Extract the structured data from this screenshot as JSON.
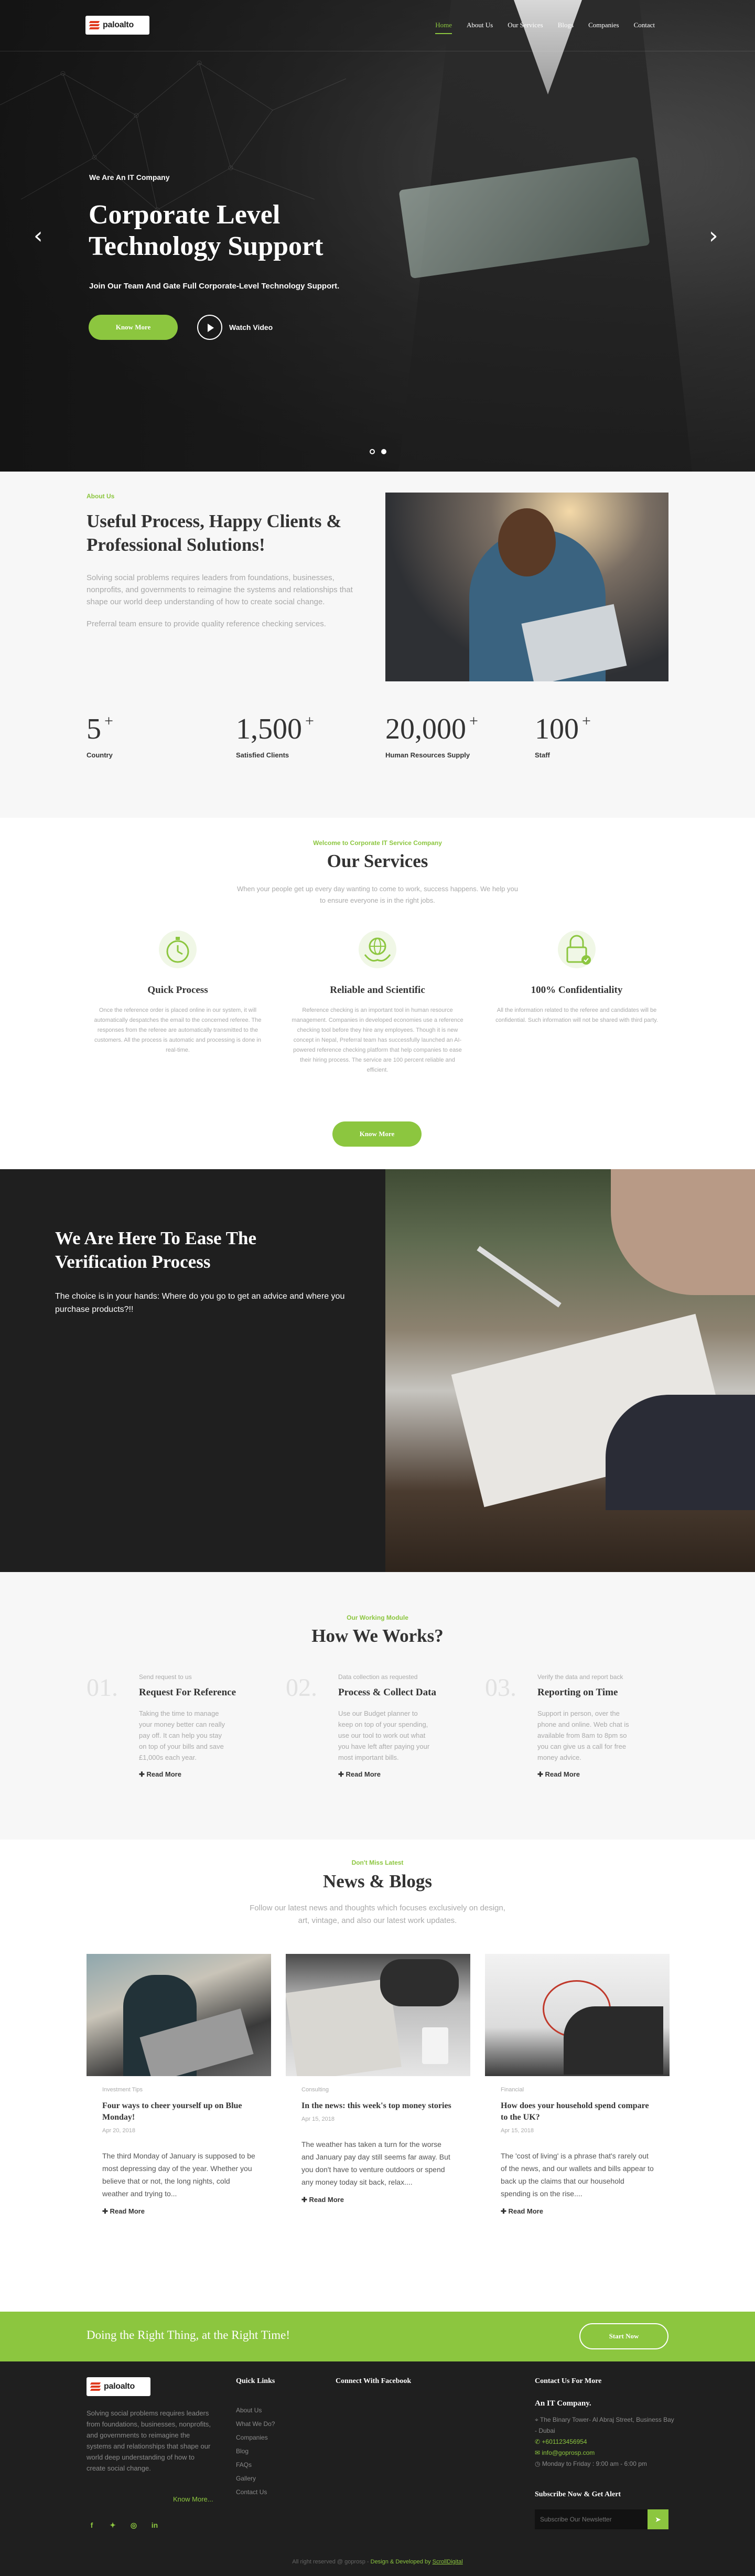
{
  "brand": {
    "name": "paloalto",
    "accent": "#8cc63f",
    "dark": "#1f1f1f"
  },
  "nav": [
    {
      "label": "Home",
      "active": true
    },
    {
      "label": "About Us"
    },
    {
      "label": "Our Services"
    },
    {
      "label": "Blogs"
    },
    {
      "label": "Companies"
    },
    {
      "label": "Contact"
    }
  ],
  "hero": {
    "eyebrow": "We Are An IT Company",
    "title_line1": "Corporate Level",
    "title_line2": "Technology Support",
    "subtitle": "Join Our Team And Gate Full Corporate-Level Technology Support.",
    "button": "Know More",
    "video_label": "Watch Video",
    "prev_icon": "chevron-left-icon",
    "next_icon": "chevron-right-icon"
  },
  "about": {
    "eyebrow": "About Us",
    "title": "Useful Process, Happy Clients & Professional Solutions!",
    "para1": "Solving social problems requires leaders from foundations, businesses, nonprofits, and governments to reimagine the systems and relationships that shape our world deep understanding of how to create social change.",
    "para2": "Preferral team ensure to provide quality reference checking services."
  },
  "stats": [
    {
      "value": "5",
      "label": "Country"
    },
    {
      "value": "1,500",
      "label": "Satisfied Clients"
    },
    {
      "value": "20,000",
      "label": "Human Resources Supply"
    },
    {
      "value": "100",
      "label": "Staff"
    }
  ],
  "stats_suffix": "+",
  "services": {
    "eyebrow": "Welcome to Corporate IT Service Company",
    "title": "Our Services",
    "desc_line1": "When your people get up every day wanting to come to work, success happens. We help you",
    "desc_line2": "to ensure everyone is in the right jobs.",
    "items": [
      {
        "icon": "stopwatch-icon",
        "title": "Quick Process",
        "text": "Once the reference order is placed online in our system, it will automatically despatches the email to the concerned referee. The responses from the referee are automatically transmitted to the customers. All the process is automatic and processing is done in real-time."
      },
      {
        "icon": "globe-hands-icon",
        "title": "Reliable and Scientific",
        "text": "Reference checking is an important tool in human resource management. Companies in developed economies use a reference checking tool before they hire any employees. Though it is new concept in Nepal, Preferral team has successfully launched an AI-powered reference checking platform that help companies to ease their hiring process. The service are 100 percent reliable and efficient."
      },
      {
        "icon": "padlock-icon",
        "title": "100% Confidentiality",
        "text": "All the information related to the referee and candidates will be confidential. Such information will not be shared with third party."
      }
    ],
    "button": "Know More"
  },
  "verification": {
    "title_line1": "We Are Here To Ease The",
    "title_line2": "Verification Process",
    "text": "The choice is in your hands: Where do you go to get an advice and where you purchase products?!!"
  },
  "how": {
    "eyebrow": "Our Working Module",
    "title": "How We Works?",
    "steps": [
      {
        "num": "01.",
        "kicker": "Send request to us",
        "title": "Request For Reference",
        "text": "Taking the time to manage your money better can really pay off. It can help you stay on top of your bills and save £1,000s each year.",
        "link": "Read More"
      },
      {
        "num": "02.",
        "kicker": "Data collection as requested",
        "title": "Process & Collect Data",
        "text": "Use our Budget planner to keep on top of your spending, use our tool to work out what you have left after paying your most important bills.",
        "link": "Read More"
      },
      {
        "num": "03.",
        "kicker": "Verify the data and report back",
        "title": "Reporting on Time",
        "text": "Support in person, over the phone and online. Web chat is available from 8am to 8pm so you can give us a call for free money advice.",
        "link": "Read More"
      }
    ]
  },
  "news": {
    "eyebrow": "Don't Miss Latest",
    "title": "News & Blogs",
    "desc_line1": "Follow our latest news and thoughts which focuses exclusively on design,",
    "desc_line2": "art, vintage, and also our latest work updates.",
    "cards": [
      {
        "category": "Investment Tips",
        "title": "Four ways to cheer yourself up on Blue Monday!",
        "date": "Apr 20, 2018",
        "text": "The third Monday of January is supposed to be most depressing day of the year. Whether you believe that or not, the long nights, cold weather and trying to...",
        "link": "Read More"
      },
      {
        "category": "Consulting",
        "title": "In the news: this week's top money stories",
        "date": "Apr 15, 2018",
        "text": "The weather has taken a turn for the worse and January pay day still seems far away. But you don't have to venture outdoors or spend any money today sit back, relax....",
        "link": "Read More"
      },
      {
        "category": "Financial",
        "title": "How does your household spend compare to the UK?",
        "date": "Apr 15, 2018",
        "text": "The 'cost of living' is a phrase that's rarely out of the news, and our wallets and bills appear to back up the claims that our household spending is on the rise....",
        "link": "Read More"
      }
    ]
  },
  "cta": {
    "text": "Doing the Right Thing, at the Right Time!",
    "button": "Start Now"
  },
  "footer": {
    "about": "Solving social problems requires leaders from foundations, businesses, nonprofits, and governments to reimagine the systems and relationships that shape our world deep understanding of how to create social change.",
    "more": "Know More...",
    "quick_links_title": "Quick Links",
    "links": [
      "About Us",
      "What We Do?",
      "Companies",
      "Blog",
      "FAQs",
      "Gallery",
      "Contact Us"
    ],
    "facebook_title": "Connect With Facebook",
    "contact_title": "Contact Us For More",
    "company": "An IT Company.",
    "address": "The Binary Tower- Al Abraj Street, Business Bay - Dubai",
    "phone": "+601123456954",
    "email": "info@goprosp.com",
    "hours": "Monday to Friday : 9:00 am - 6:00 pm",
    "subscribe_title": "Subscribe Now & Get Alert",
    "subscribe_placeholder": "Subscribe Our Newsletter",
    "copyright_prefix": "All right reserved @ goprosp - ",
    "copyright_credit": "Design & Developed by ",
    "copyright_link": "ScrollDigital"
  }
}
